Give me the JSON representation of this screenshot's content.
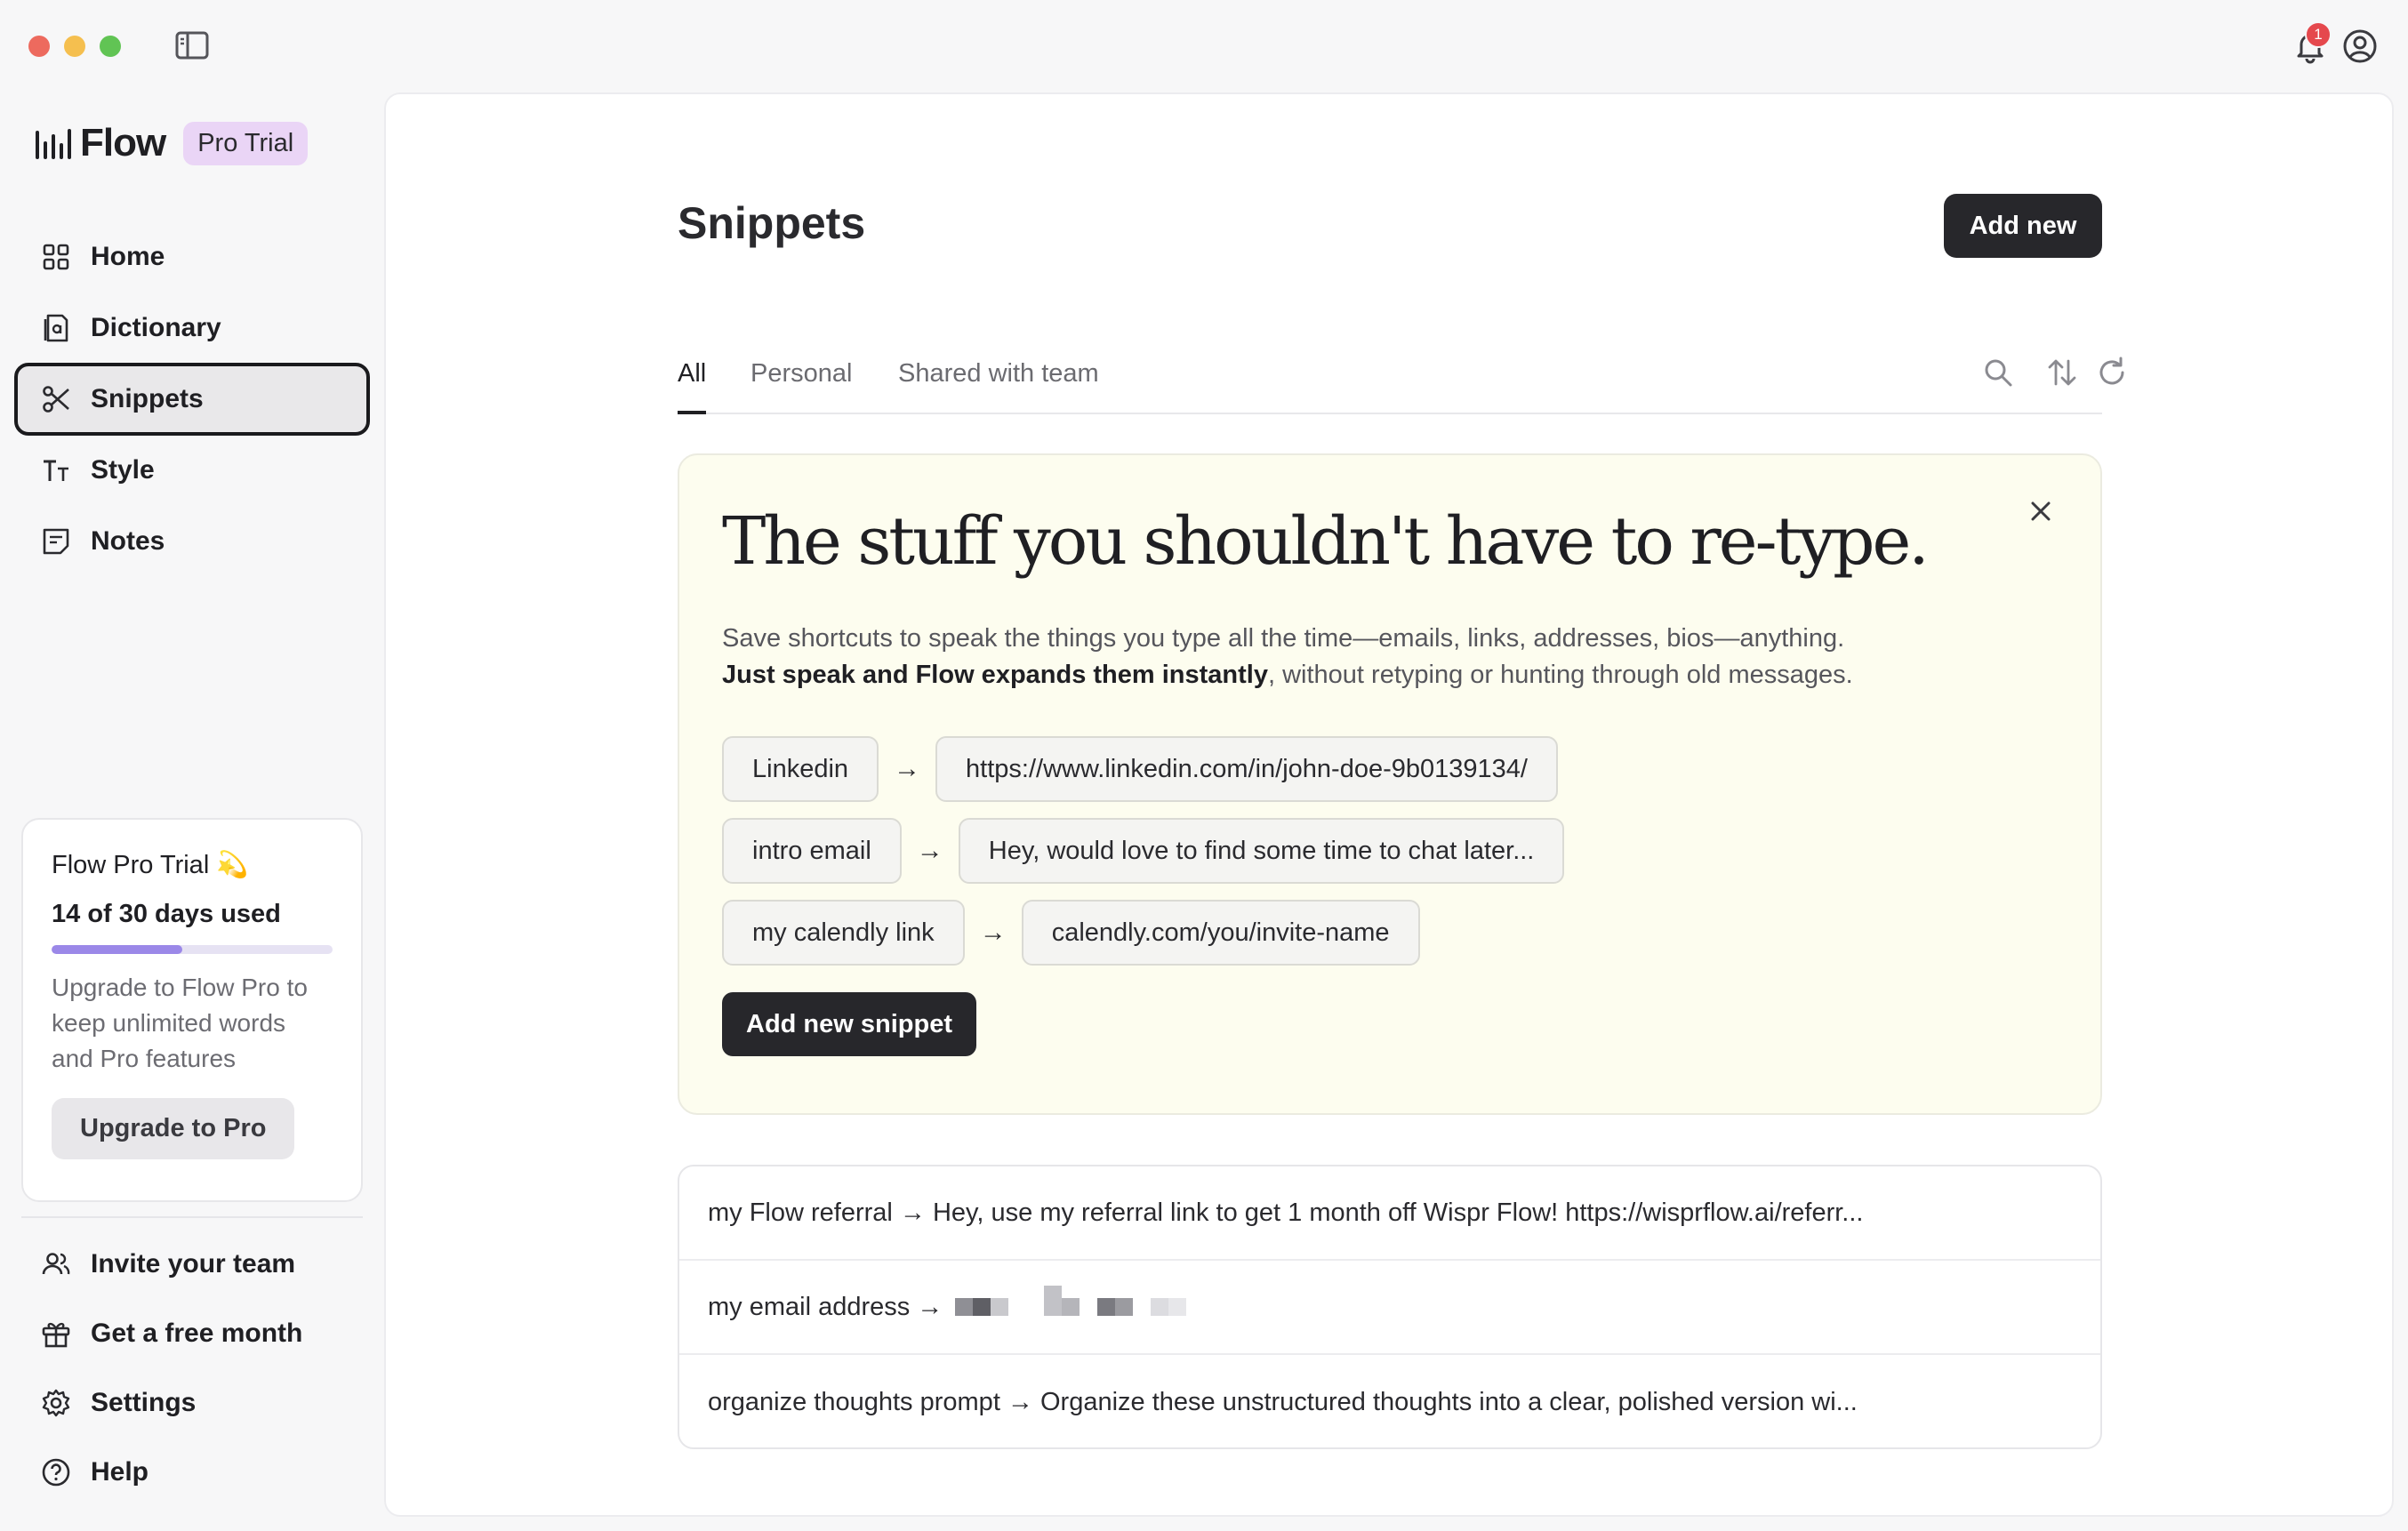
{
  "titlebar": {
    "notification_count": "1",
    "icons": [
      "sidebar-toggle-icon",
      "bell-icon",
      "account-icon"
    ]
  },
  "sidebar": {
    "brand_name": "Flow",
    "badge": "Pro Trial",
    "items": [
      {
        "label": "Home",
        "icon": "home-grid-icon"
      },
      {
        "label": "Dictionary",
        "icon": "dictionary-icon"
      },
      {
        "label": "Snippets",
        "icon": "scissors-icon",
        "active": true
      },
      {
        "label": "Style",
        "icon": "text-style-icon"
      },
      {
        "label": "Notes",
        "icon": "notes-icon"
      }
    ],
    "trial": {
      "title": "Flow Pro Trial 💫",
      "days_used": "14 of 30 days used",
      "progress_fraction": 0.4667,
      "description": "Upgrade to Flow Pro to keep unlimited words and Pro features",
      "upgrade_label": "Upgrade to Pro"
    },
    "bottom_items": [
      {
        "label": "Invite your team",
        "icon": "invite-team-icon"
      },
      {
        "label": "Get a free month",
        "icon": "gift-icon"
      },
      {
        "label": "Settings",
        "icon": "gear-icon"
      },
      {
        "label": "Help",
        "icon": "help-icon"
      }
    ]
  },
  "main": {
    "title": "Snippets",
    "add_new_label": "Add new",
    "tabs": [
      {
        "label": "All",
        "active": true
      },
      {
        "label": "Personal"
      },
      {
        "label": "Shared with team"
      }
    ],
    "promo": {
      "headline": "The stuff you shouldn't have to re-type.",
      "line1": "Save shortcuts to speak the things you type all the time—emails, links, addresses, bios—anything.",
      "line2_bold": "Just speak and Flow expands them instantly",
      "line2_rest": ", without retyping or hunting through old messages.",
      "examples": [
        {
          "trigger": "Linkedin",
          "expansion": "https://www.linkedin.com/in/john-doe-9b0139134/"
        },
        {
          "trigger": "intro email",
          "expansion": "Hey, would love to find some time to chat later..."
        },
        {
          "trigger": "my calendly link",
          "expansion": "calendly.com/you/invite-name"
        }
      ],
      "arrow": "→",
      "add_snippet_label": "Add new snippet"
    },
    "snippets": [
      "my Flow referral → Hey, use my referral link to get 1 month off Wispr Flow! https://wisprflow.ai/referr...",
      "my email address →",
      "organize thoughts prompt → Organize these unstructured thoughts into a clear, polished version wi..."
    ]
  },
  "colors": {
    "accent_dark": "#27272b",
    "badge_bg": "#ead5f6",
    "progress_fill": "#9b88e8",
    "promo_bg": "#fdfdef",
    "notification_red": "#e5484d"
  }
}
